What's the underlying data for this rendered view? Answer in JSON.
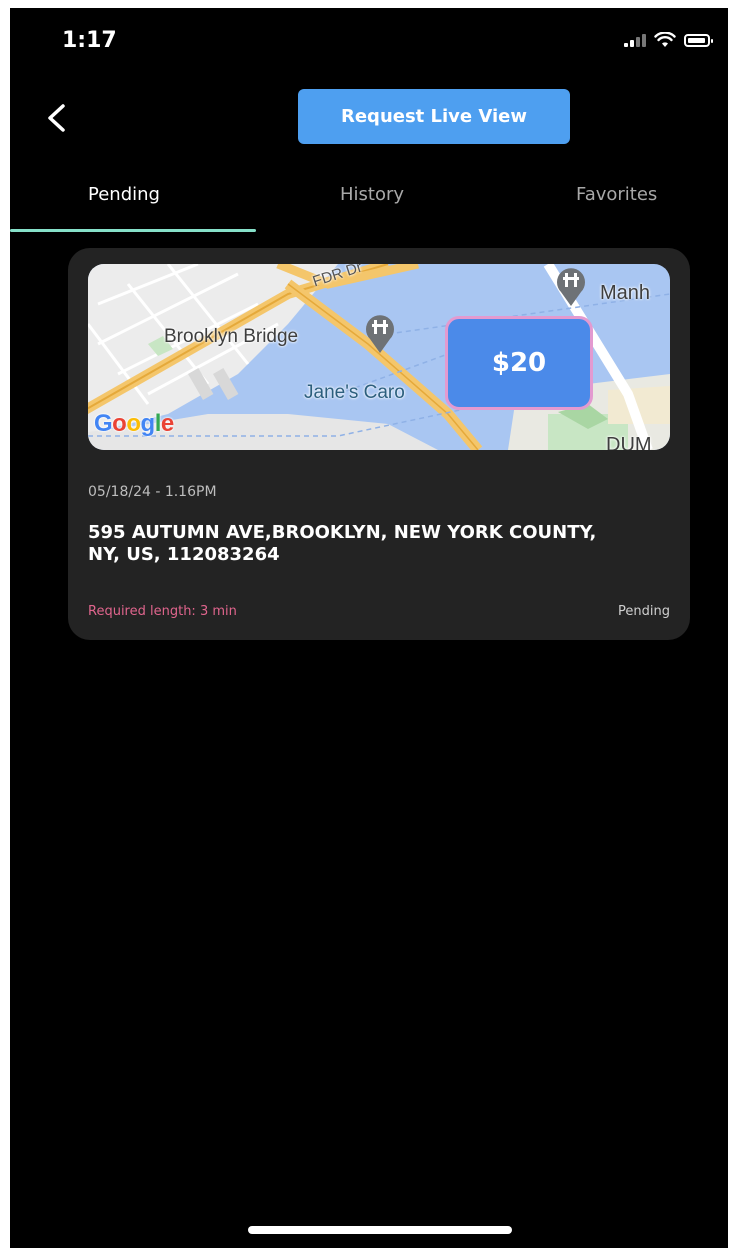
{
  "status_bar": {
    "time": "1:17",
    "icons": [
      "signal-icon",
      "wifi-icon",
      "battery-icon"
    ]
  },
  "header": {
    "back_icon": "chevron-left-icon",
    "request_button_label": "Request Live View"
  },
  "tabs": [
    {
      "label": "Pending",
      "active": true
    },
    {
      "label": "History",
      "active": false
    },
    {
      "label": "Favorites",
      "active": false
    }
  ],
  "request_card": {
    "map": {
      "labels": {
        "road": "FDR Dr",
        "bridge": "Brooklyn Bridge",
        "carousel": "Jane's Caro",
        "manhattan": "Manh",
        "dumbo": "DUM"
      },
      "provider": "Google"
    },
    "price": "$20",
    "datetime": "05/18/24 - 1.16PM",
    "address": "595 AUTUMN AVE,BROOKLYN, NEW YORK COUNTY, NY, US, 112083264",
    "required_length": "Required length: 3 min",
    "status": "Pending"
  },
  "colors": {
    "background": "#000000",
    "accent_button": "#4e9ff0",
    "tab_underline": "#86e0c9",
    "card_bg": "#232323",
    "required_length": "#e0658d",
    "price_badge": "#4b8ae9",
    "price_border": "#e39ad0"
  }
}
